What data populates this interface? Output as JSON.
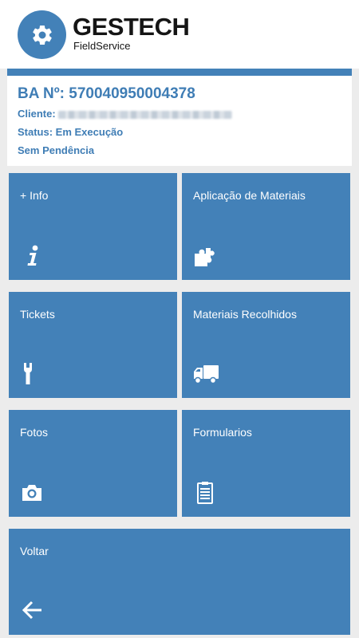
{
  "header": {
    "brand": "GESTECH",
    "subbrand": "FieldService",
    "logo_icon": "gear-icon",
    "brand_color": "#4381b8"
  },
  "order": {
    "ba_number": "BA Nº: 570040950004378",
    "client_label": "Cliente:",
    "status": "Status: Em Execução",
    "pending": "Sem Pendência"
  },
  "tiles": [
    {
      "label": "+ Info",
      "icon": "info-icon"
    },
    {
      "label": "Aplicação de Materiais",
      "icon": "puzzle-icon"
    },
    {
      "label": "Tickets",
      "icon": "wrench-icon"
    },
    {
      "label": "Materiais Recolhidos",
      "icon": "truck-icon"
    },
    {
      "label": "Fotos",
      "icon": "camera-icon"
    },
    {
      "label": "Formularios",
      "icon": "clipboard-icon"
    },
    {
      "label": "Voltar",
      "icon": "arrow-left-icon"
    }
  ]
}
